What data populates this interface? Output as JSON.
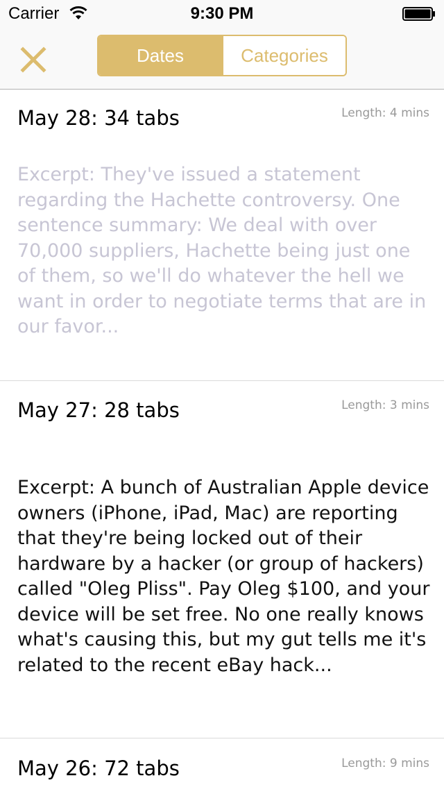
{
  "status_bar": {
    "carrier": "Carrier",
    "time": "9:30 PM",
    "wifi_icon": "wifi-icon",
    "battery_icon": "battery-full-icon"
  },
  "nav_bar": {
    "close_icon": "close-x-icon",
    "accent_color": "#dcbc6e",
    "segments": [
      {
        "label": "Dates",
        "selected": true
      },
      {
        "label": "Categories",
        "selected": false
      }
    ]
  },
  "items": [
    {
      "date": "May 28: 34 tabs",
      "length": "Length: 4 mins",
      "excerpt": "Excerpt: They've issued a statement regarding the Hachette controversy. One sentence summary: We deal with over 70,000 suppliers, Hachette being just one of them, so we'll do whatever the hell we want in order to negotiate terms that are in our favor...",
      "excerpt_color": "#c7c5d4"
    },
    {
      "date": "May 27: 28 tabs",
      "length": "Length: 3 mins",
      "excerpt": "Excerpt: A bunch of Australian Apple device owners (iPhone, iPad, Mac) are reporting that they're being locked out of their hardware by a hacker (or group of hackers) called \"Oleg Pliss\". Pay Oleg $100, and your device will be set free. No one really knows what's causing this, but my gut tells me it's related to the recent eBay hack...",
      "excerpt_color": "#111111"
    },
    {
      "date": "May 26: 72 tabs",
      "length": "Length: 9 mins"
    }
  ]
}
